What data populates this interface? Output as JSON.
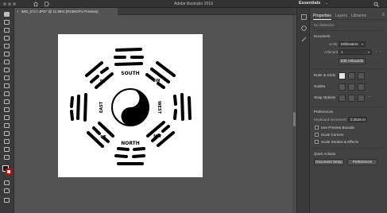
{
  "app": {
    "title": "Adobe Illustrator 2019",
    "workspace": "Essentials"
  },
  "document": {
    "tab_label": "IMG_0717.JPG* @ 11.95% (RGB/GPU Preview)",
    "close_label": "×"
  },
  "panel": {
    "tabs": [
      {
        "label": "Properties",
        "active": true
      },
      {
        "label": "Layers",
        "active": false
      },
      {
        "label": "Libraries",
        "active": false
      }
    ],
    "menu_glyph": "≡",
    "no_selection": "No Selection",
    "document_section": "Document",
    "units_label": "Units:",
    "units_value": "Millimeters",
    "artboard_label": "Artboard:",
    "artboard_value": "1",
    "edit_artboards": "Edit Artboards",
    "ruler_grids": "Ruler & Grids",
    "guides": "Guides",
    "snap_options": "Snap Options",
    "preferences_section": "Preferences",
    "keyboard_increment_label": "Keyboard Increment:",
    "keyboard_increment_value": "0.3528 m",
    "use_preview_bounds": "Use Preview Bounds",
    "scale_corners": "Scale Corners",
    "scale_strokes": "Scale Strokes & Effects",
    "quick_actions": "Quick Actions",
    "document_setup": "Document Setup",
    "preferences_button": "Preferences"
  },
  "artwork": {
    "labels": {
      "south": "SOUTH",
      "north": "NORTH",
      "east": "EAST",
      "west": "WEST",
      "se": "SE",
      "sw": "SW",
      "ne": "NE",
      "nw": "NW"
    }
  },
  "colors": {
    "chrome": "#323232",
    "canvas": "#535353",
    "panel": "#424242",
    "fill_swatch": "#111111",
    "stroke_swatch": "#cc0000"
  }
}
